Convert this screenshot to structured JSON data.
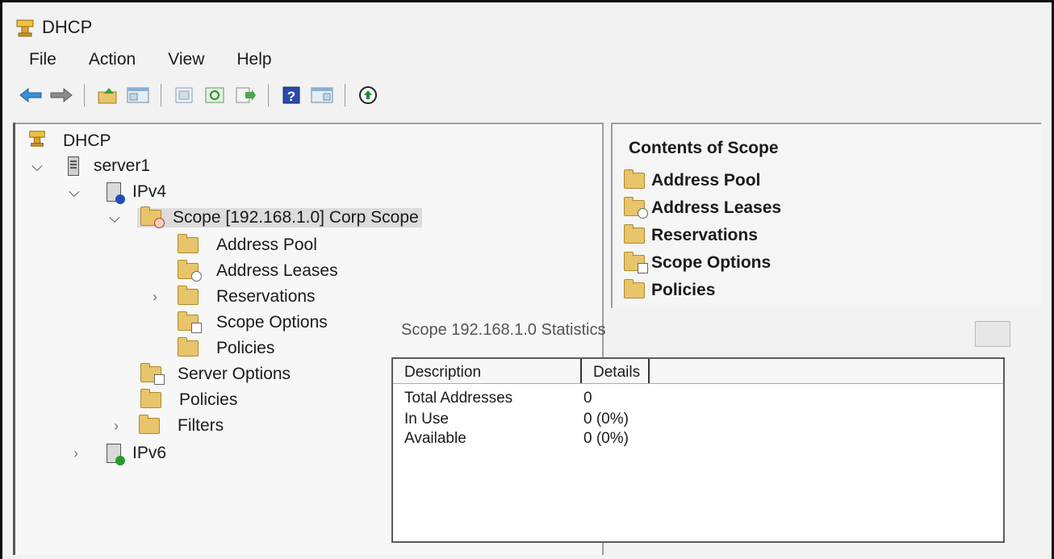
{
  "window": {
    "title": "DHCP"
  },
  "menu": [
    "File",
    "Action",
    "View",
    "Help"
  ],
  "toolbar": {
    "icons": [
      "back-arrow-icon",
      "forward-arrow-icon",
      "up-folder-icon",
      "show-hide-tree-icon",
      "properties-icon",
      "refresh-icon",
      "export-list-icon",
      "help-icon",
      "show-hide-action-pane-icon",
      "activate-icon"
    ]
  },
  "tree": {
    "root": "DHCP",
    "server": "server1",
    "ipv4": "IPv4",
    "scope": "Scope [192.168.1.0] Corp Scope",
    "address_pool": "Address Pool",
    "address_leases": "Address Leases",
    "reservations": "Reservations",
    "scope_options": "Scope Options",
    "scope_policies": "Policies",
    "server_options": "Server Options",
    "ipv4_policies": "Policies",
    "filters": "Filters",
    "ipv6": "IPv6"
  },
  "contents": {
    "title": "Contents of Scope",
    "items": [
      "Address Pool",
      "Address Leases",
      "Reservations",
      "Scope Options",
      "Policies"
    ]
  },
  "stats": {
    "title": "Scope 192.168.1.0 Statistics",
    "columns": [
      "Description",
      "Details"
    ],
    "rows": [
      {
        "description": "Total Addresses",
        "details": "0"
      },
      {
        "description": "In Use",
        "details": "0 (0%)"
      },
      {
        "description": "Available",
        "details": "0 (0%)"
      }
    ]
  }
}
